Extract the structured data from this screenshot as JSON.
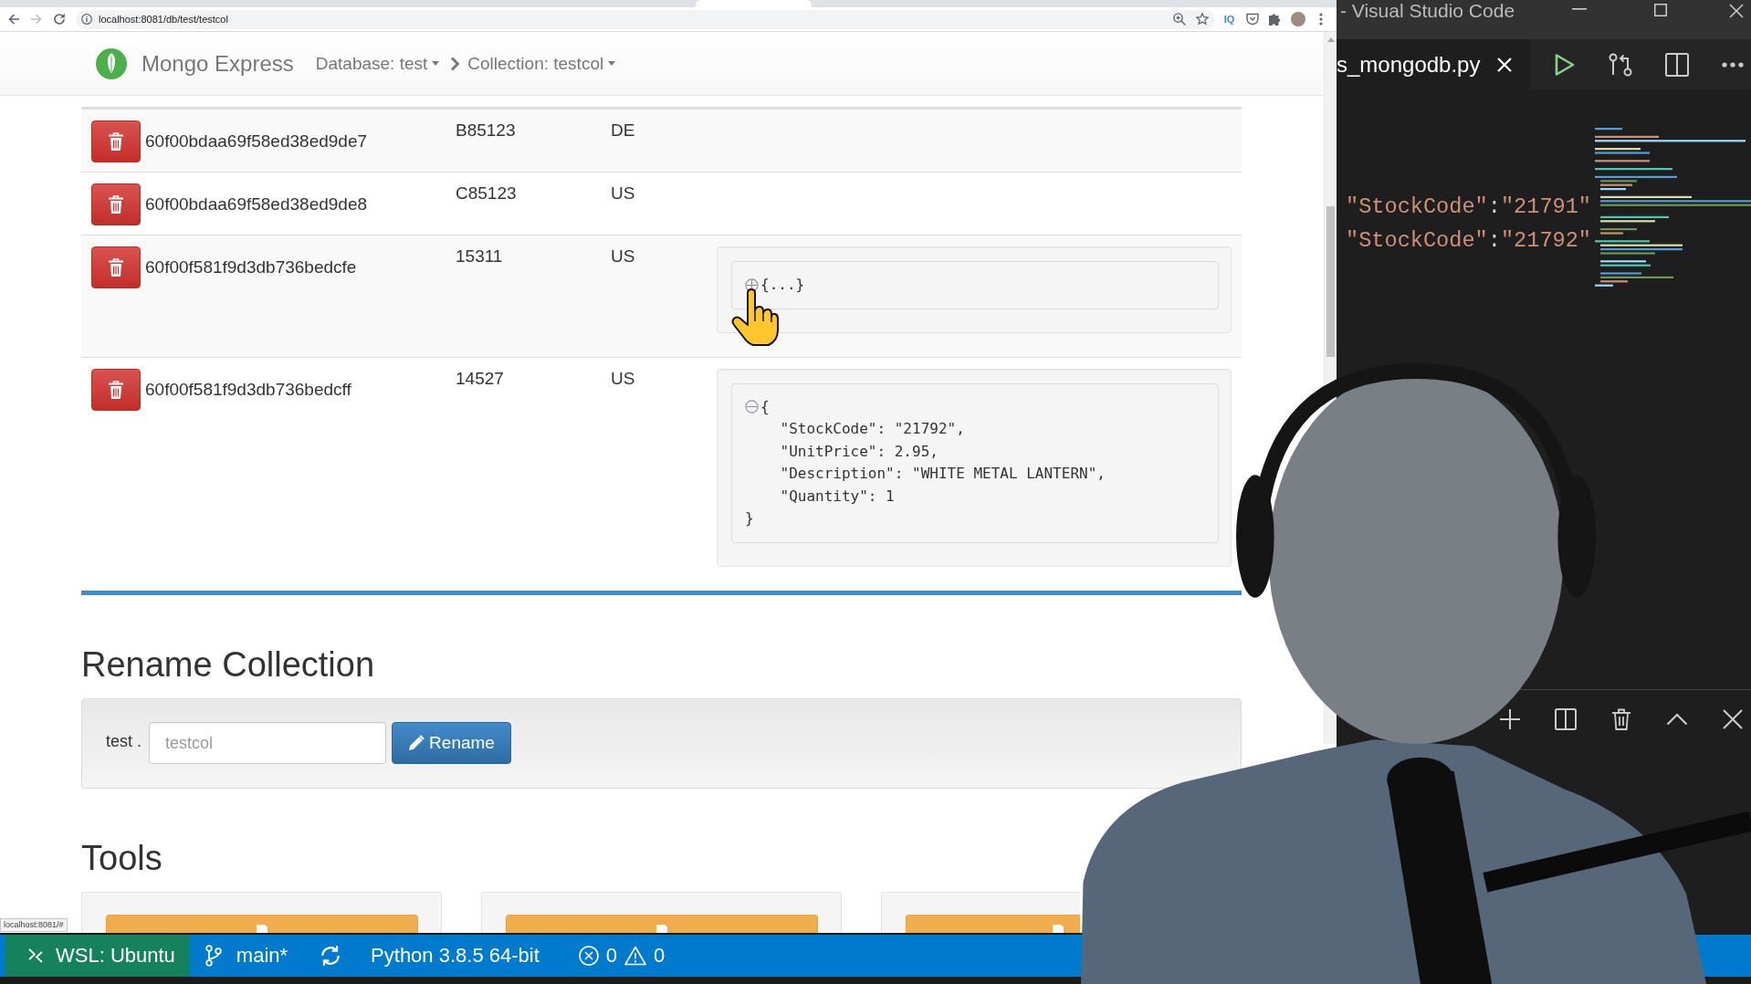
{
  "browser": {
    "url": "localhost:8081/db/test/testcol",
    "extension_label": "IQ",
    "status_link": "localhost:8081/#"
  },
  "navbar": {
    "brand": "Mongo Express",
    "breadcrumbs": [
      {
        "label": "Database: test"
      },
      {
        "label": "Collection: testcol"
      }
    ]
  },
  "table": {
    "rows": [
      {
        "cells": [
          "60f00bdaa69f58ed38ed9de7",
          "B85123",
          "DE"
        ]
      },
      {
        "cells": [
          "60f00bdaa69f58ed38ed9de8",
          "C85123",
          "US"
        ]
      },
      {
        "cells": [
          "60f00f581f9d3db736bedcfe",
          "15311",
          "US"
        ],
        "document": {
          "expanded": false,
          "head": "{...}"
        }
      },
      {
        "cells": [
          "60f00f581f9d3db736bedcff",
          "14527",
          "US"
        ],
        "document": {
          "expanded": true,
          "head": "{",
          "fields": [
            "\"StockCode\": \"21792\",",
            "\"UnitPrice\": 2.95,",
            "\"Description\": \"WHITE METAL LANTERN\",",
            "\"Quantity\": 1"
          ],
          "tail": "}"
        }
      }
    ]
  },
  "rename": {
    "heading": "Rename Collection",
    "database_label": "test .",
    "input": {
      "placeholder": "testcol"
    },
    "button": "Rename"
  },
  "tools": {
    "heading": "Tools"
  },
  "vscode": {
    "title": "- Visual Studio Code",
    "tab": {
      "label": "s_mongodb.py"
    },
    "code_lines": [
      {
        "tokens": [
          {
            "kind": "string",
            "text": "\"StockCode\""
          },
          {
            "kind": "punctuation",
            "text": ":"
          },
          {
            "kind": "string",
            "text": "\"21791\""
          }
        ]
      },
      {
        "tokens": [
          {
            "kind": "string",
            "text": "\"StockCode\""
          },
          {
            "kind": "punctuation",
            "text": ":"
          },
          {
            "kind": "string",
            "text": "\"21792\""
          }
        ]
      }
    ]
  },
  "status_bar": {
    "remote": "WSL: Ubuntu",
    "branch": "main*",
    "interpreter": "Python 3.8.5 64-bit",
    "errors": "0",
    "warnings": "0"
  }
}
